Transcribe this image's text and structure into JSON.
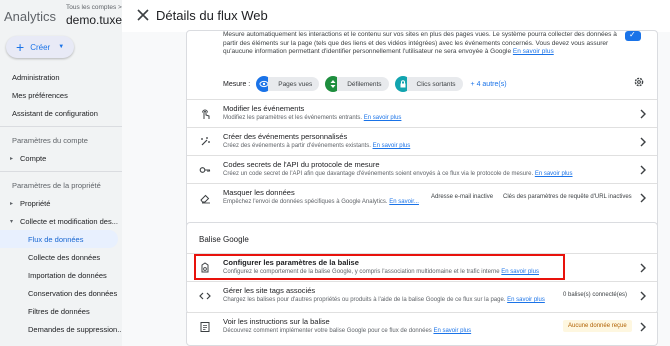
{
  "sidebar": {
    "app_title": "Analytics",
    "account_small": "Tous les comptes >",
    "account_name": "demo.tuxed",
    "create_label": "Créer",
    "items": [
      {
        "label": "Administration"
      },
      {
        "label": "Mes préférences"
      },
      {
        "label": "Assistant de configuration"
      }
    ],
    "section_account": "Paramètres du compte",
    "account_item": "Compte",
    "section_property": "Paramètres de la propriété",
    "property_item": "Propriété",
    "collect_item": "Collecte et modification des...",
    "subitems": [
      {
        "label": "Flux de données"
      },
      {
        "label": "Collecte des données"
      },
      {
        "label": "Importation de données"
      },
      {
        "label": "Conservation des données"
      },
      {
        "label": "Filtres de données"
      },
      {
        "label": "Demandes de suppression..."
      }
    ]
  },
  "panel": {
    "title": "Détails du flux Web",
    "top_text": "Le système pourra collecter des données à partir des éléments sur la page (tels que des liens et des vidéos intégrées) avec les événements concernés. Vous devez vous assurer qu'aucune information permettant d'identifier personnellement l'utilisateur ne sera envoyée à Google",
    "top_text_line0": "Mesure automatiquement les interactions et le contenu sur vos sites en plus des pages vues.",
    "top_link": "En savoir plus",
    "measure_label": "Mesure :",
    "chips": [
      {
        "label": "Pages vues",
        "color": "#1a73e8",
        "icon": "eye-icon"
      },
      {
        "label": "Défilements",
        "color": "#1e8e3e",
        "icon": "scroll-icon"
      },
      {
        "label": "Clics sortants",
        "color": "#12a4af",
        "icon": "lock-icon"
      }
    ],
    "more_link": "+ 4 autre(s)",
    "rows": [
      {
        "title": "Modifier les événements",
        "desc": "Modifiez les paramètres et les événements entrants.",
        "link": "En savoir plus"
      },
      {
        "title": "Créer des événements personnalisés",
        "desc": "Créez des événements à partir d'événements existants.",
        "link": "En savoir plus"
      },
      {
        "title": "Codes secrets de l'API du protocole de mesure",
        "desc": "Créez un code secret de l'API afin que davantage d'événements soient envoyés à ce flux via le protocole de mesure.",
        "link": "En savoir plus"
      },
      {
        "title": "Masquer les données",
        "desc": "Empêchez l'envoi de données spécifiques à Google Analytics.",
        "link": "En savoir...",
        "side1": "Adresse e-mail inactive",
        "side2": "Clés des paramètres de requête d'URL inactives"
      }
    ],
    "google_tag": {
      "title": "Balise Google",
      "rows": [
        {
          "title": "Configurer les paramètres de la balise",
          "desc": "Configurez le comportement de la balise Google, y compris l'association multidomaine et le trafic interne",
          "link": "En savoir plus"
        },
        {
          "title": "Gérer les site tags associés",
          "desc": "Chargez les balises pour d'autres propriétés ou produits à l'aide de la balise Google de ce flux sur la page.",
          "link": "En savoir plus",
          "side": "0 balise(s) connecté(es)"
        },
        {
          "title": "Voir les instructions sur la balise",
          "desc": "Découvrez comment implémenter votre balise Google pour ce flux de données",
          "link": "En savoir plus",
          "badge": "Aucune donnée reçue"
        }
      ]
    }
  },
  "colors": {
    "accent": "#1a73e8",
    "highlight": "#e8120c"
  }
}
